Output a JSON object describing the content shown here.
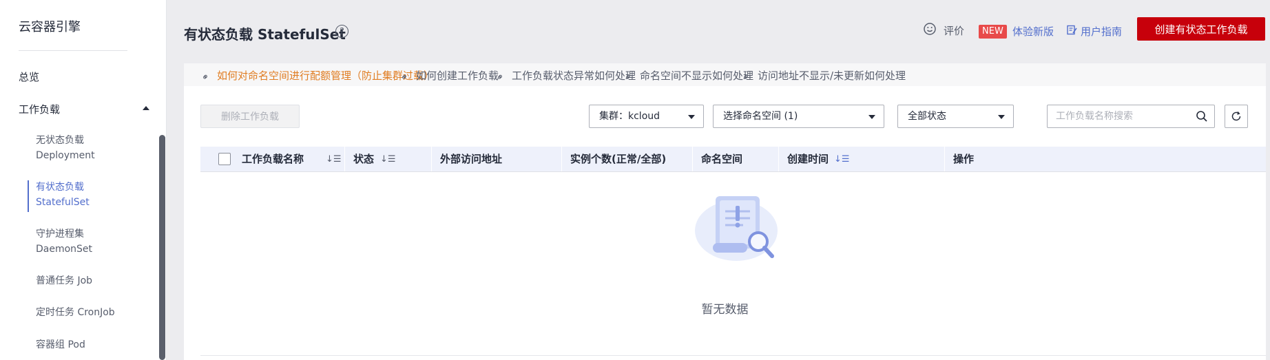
{
  "sidebar": {
    "brand": "云容器引擎",
    "overview": "总览",
    "workload": "工作负载",
    "items": [
      {
        "line1": "无状态负载",
        "line2": "Deployment"
      },
      {
        "line1": "有状态负载",
        "line2": "StatefulSet"
      },
      {
        "line1": "守护进程集",
        "line2": "DaemonSet"
      },
      {
        "line1": "普通任务 Job"
      },
      {
        "line1": "定时任务 CronJob"
      },
      {
        "line1": "容器组 Pod"
      }
    ]
  },
  "header": {
    "title": "有状态负载 StatefulSet",
    "rate": "评价",
    "new_badge": "NEW",
    "try_new": "体验新版",
    "guide": "用户指南",
    "create_button": "创建有状态工作负载"
  },
  "tips": [
    "如何对命名空间进行配额管理（防止集群过载）",
    "如何创建工作负载",
    "工作负载状态异常如何处理",
    "命名空间不显示如何处理",
    "访问地址不显示/未更新如何处理"
  ],
  "toolbar": {
    "delete_button": "删除工作负载",
    "cluster_select": "集群：kcloud",
    "namespace_select": "选择命名空间 (1)",
    "status_select": "全部状态",
    "search_placeholder": "工作负载名称搜索"
  },
  "table": {
    "columns": [
      "工作负载名称",
      "状态",
      "外部访问地址",
      "实例个数(正常/全部)",
      "命名空间",
      "创建时间",
      "操作"
    ],
    "rows": [],
    "empty_text": "暂无数据"
  },
  "colors": {
    "accent": "#526ecc",
    "primary_button": "#c7000b",
    "warning_link": "#e07d22",
    "new_badge": "#e84a4a"
  }
}
